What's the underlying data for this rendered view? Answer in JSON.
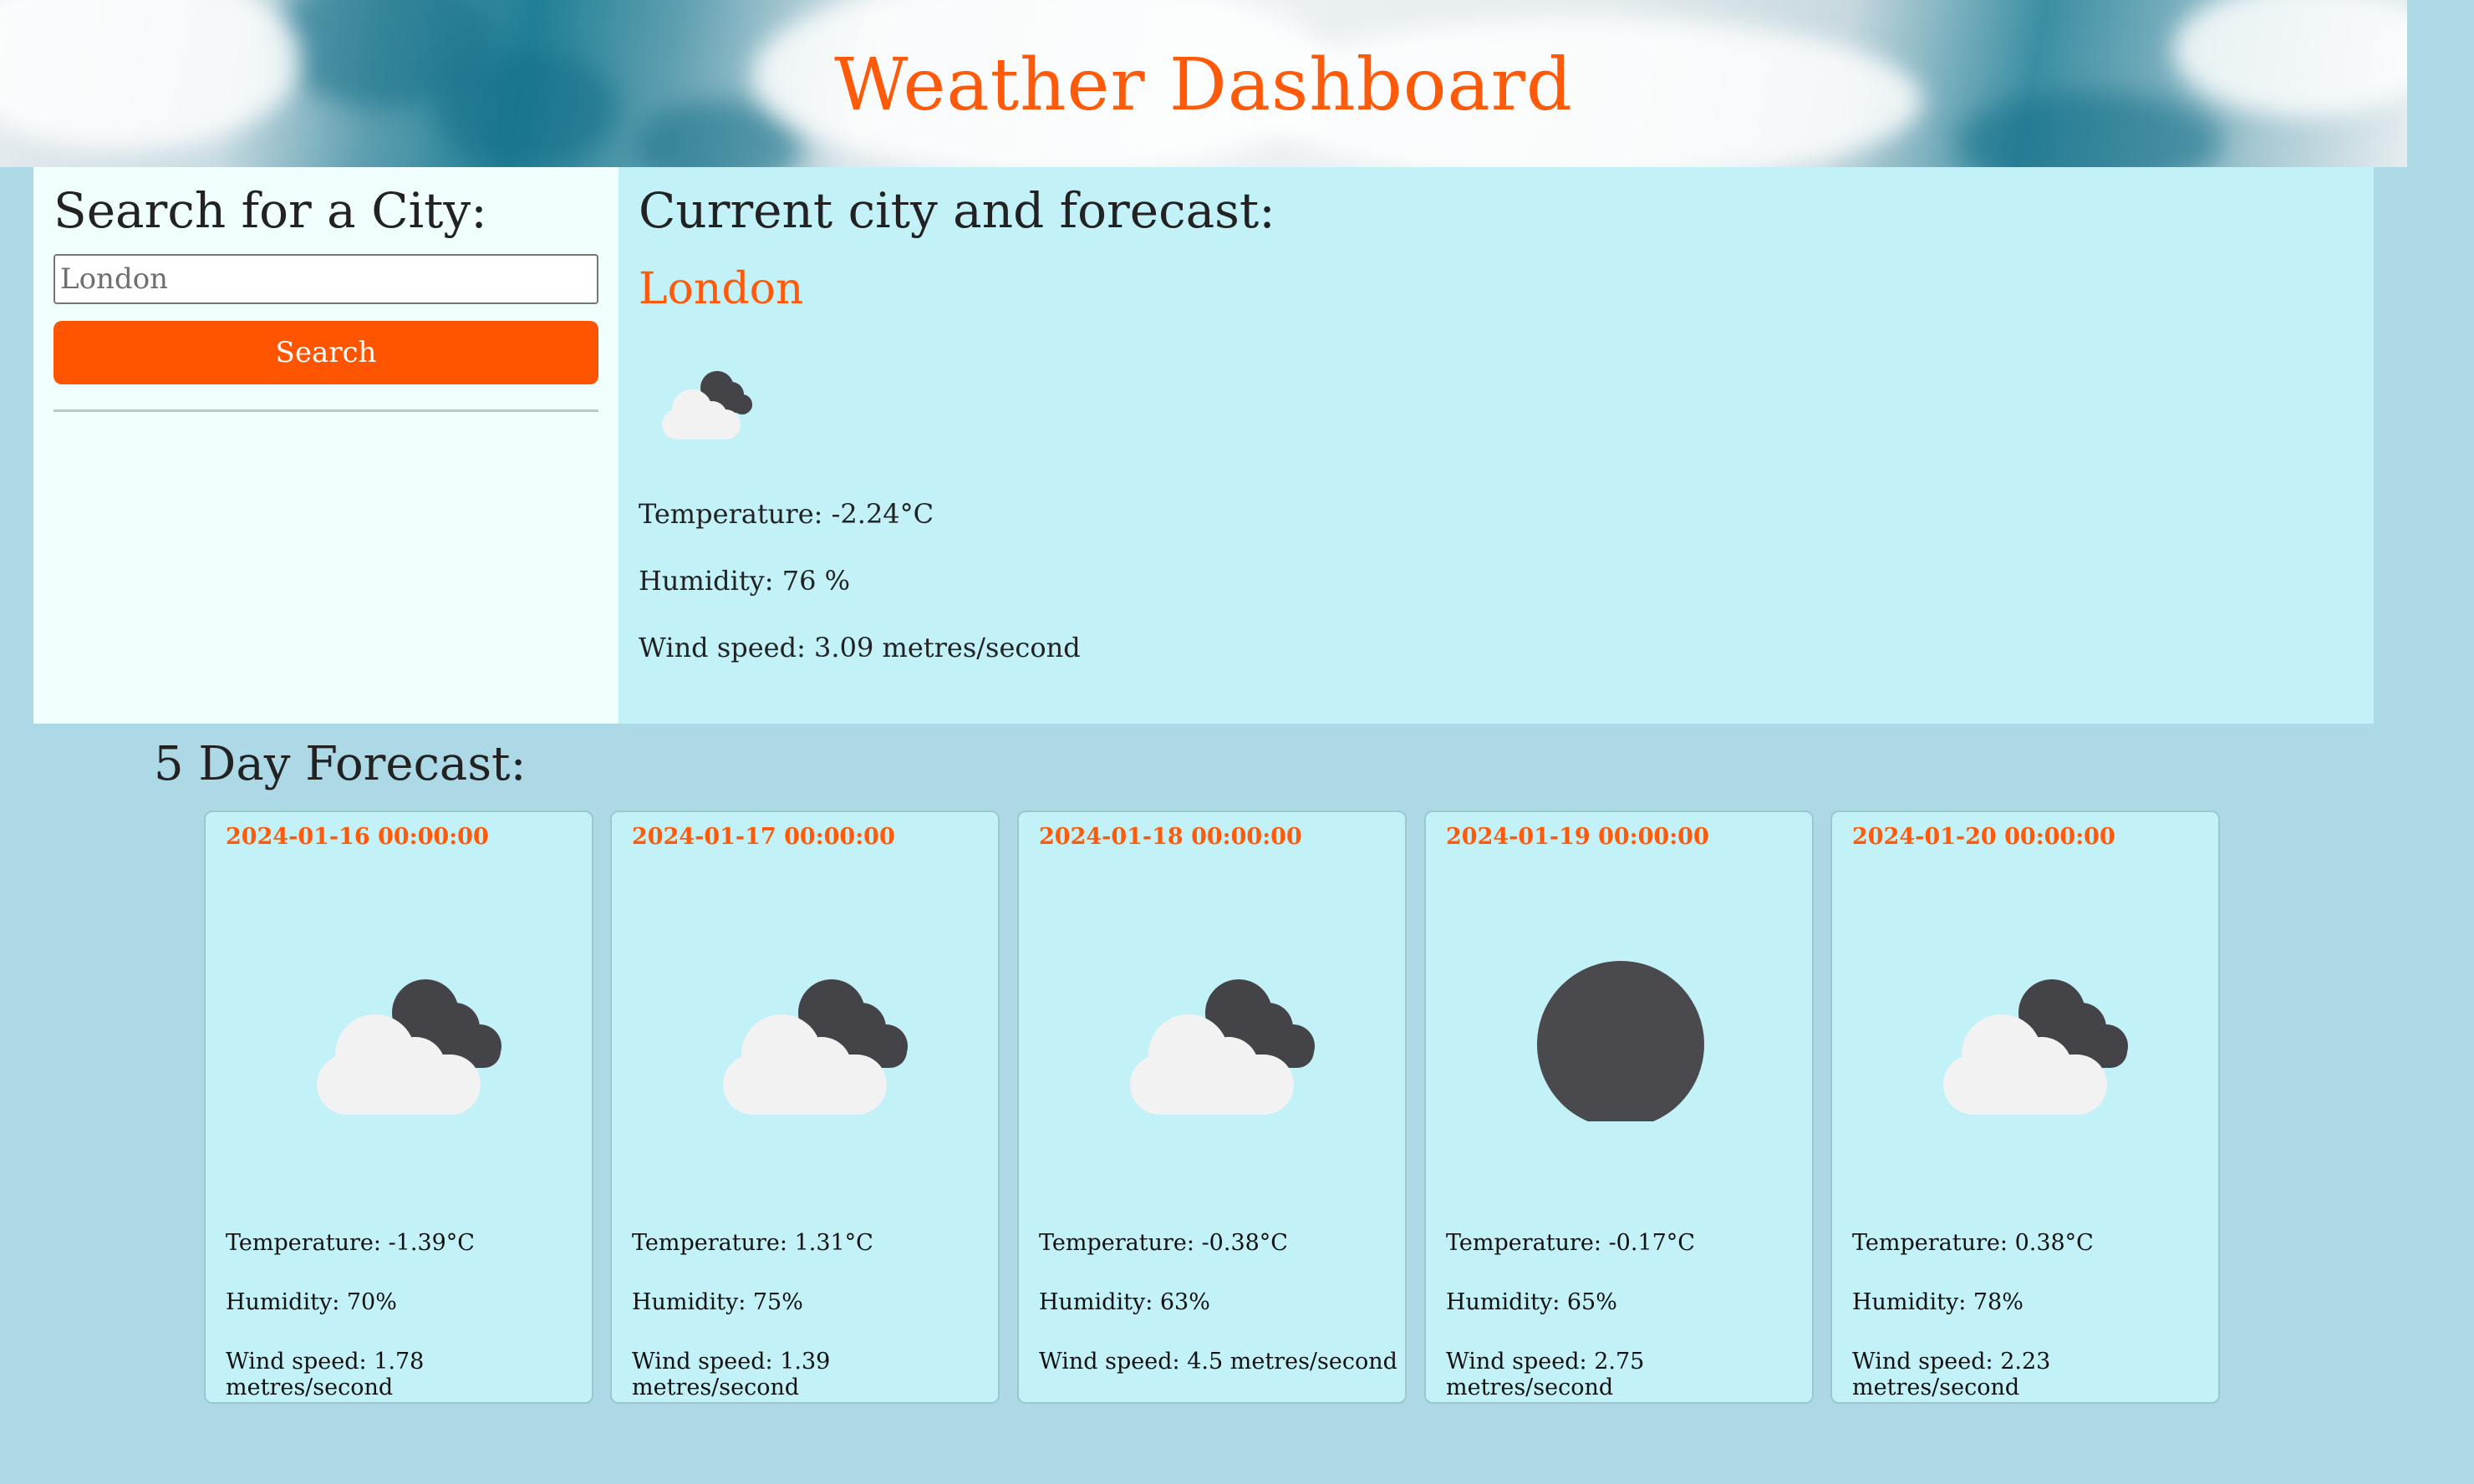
{
  "header": {
    "title": "Weather Dashboard"
  },
  "search": {
    "heading": "Search for a City:",
    "input_placeholder": "London",
    "input_value": "",
    "button_label": "Search"
  },
  "current": {
    "heading": "Current city and forecast:",
    "city": "London",
    "icon": "cloudy-icon",
    "temperature": "Temperature: -2.24°C",
    "humidity": "Humidity: 76 %",
    "wind": "Wind speed: 3.09 metres/second"
  },
  "forecast": {
    "heading": "5 Day Forecast:",
    "days": [
      {
        "date": "2024-01-16 00:00:00",
        "icon": "cloudy-icon",
        "temperature": "Temperature: -1.39°C",
        "humidity": "Humidity: 70%",
        "wind": "Wind speed: 1.78 metres/second"
      },
      {
        "date": "2024-01-17 00:00:00",
        "icon": "cloudy-icon",
        "temperature": "Temperature: 1.31°C",
        "humidity": "Humidity: 75%",
        "wind": "Wind speed: 1.39 metres/second"
      },
      {
        "date": "2024-01-18 00:00:00",
        "icon": "cloudy-icon",
        "temperature": "Temperature: -0.38°C",
        "humidity": "Humidity: 63%",
        "wind": "Wind speed: 4.5 metres/second"
      },
      {
        "date": "2024-01-19 00:00:00",
        "icon": "overcast-icon",
        "temperature": "Temperature: -0.17°C",
        "humidity": "Humidity: 65%",
        "wind": "Wind speed: 2.75 metres/second"
      },
      {
        "date": "2024-01-20 00:00:00",
        "icon": "cloudy-icon",
        "temperature": "Temperature: 0.38°C",
        "humidity": "Humidity: 78%",
        "wind": "Wind speed: 2.23 metres/second"
      }
    ]
  },
  "colors": {
    "accent": "#ff5500",
    "panel": "#c2f2f8",
    "sidebar": "#effdfd",
    "background": "#add8e6"
  }
}
